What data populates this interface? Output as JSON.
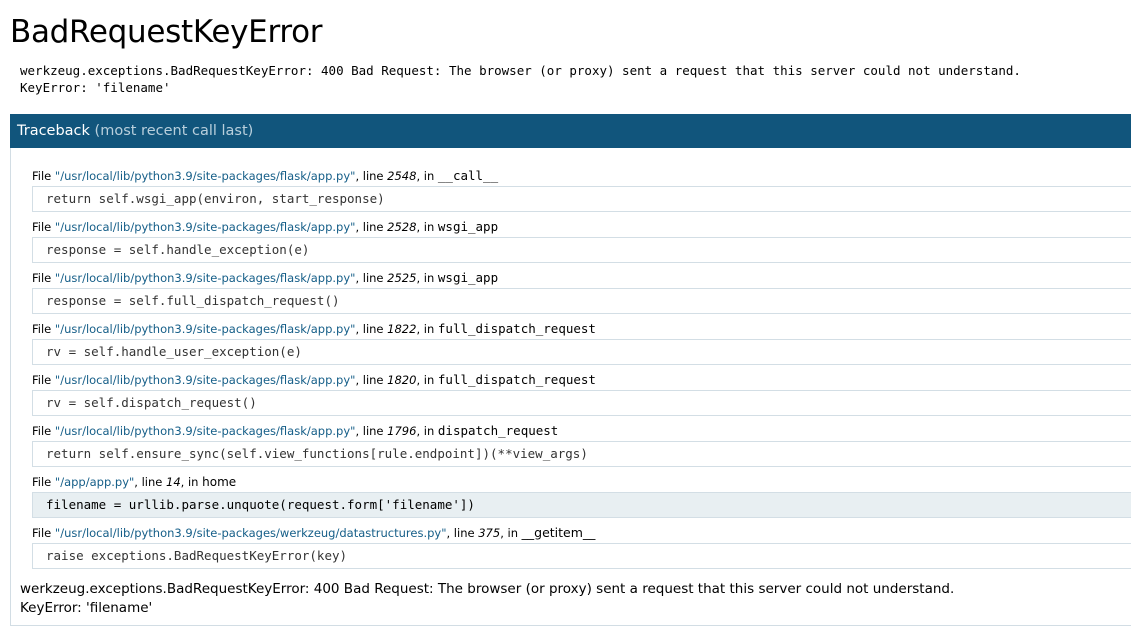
{
  "title": "BadRequestKeyError",
  "error_lines": [
    "werkzeug.exceptions.BadRequestKeyError: 400 Bad Request: The browser (or proxy) sent a request that this server could not understand.",
    "KeyError: 'filename'"
  ],
  "traceback": {
    "label": "Traceback",
    "sublabel": "(most recent call last)",
    "file_prefix": "File",
    "line_word": ", line",
    "in_word": ", in",
    "frames": [
      {
        "file": "\"/usr/local/lib/python3.9/site-packages/flask/app.py\"",
        "line": "2548",
        "func": "__call__",
        "code": "return self.wsgi_app(environ, start_response)",
        "current": false
      },
      {
        "file": "\"/usr/local/lib/python3.9/site-packages/flask/app.py\"",
        "line": "2528",
        "func": "wsgi_app",
        "code": "response = self.handle_exception(e)",
        "current": false
      },
      {
        "file": "\"/usr/local/lib/python3.9/site-packages/flask/app.py\"",
        "line": "2525",
        "func": "wsgi_app",
        "code": "response = self.full_dispatch_request()",
        "current": false
      },
      {
        "file": "\"/usr/local/lib/python3.9/site-packages/flask/app.py\"",
        "line": "1822",
        "func": "full_dispatch_request",
        "code": "rv = self.handle_user_exception(e)",
        "current": false
      },
      {
        "file": "\"/usr/local/lib/python3.9/site-packages/flask/app.py\"",
        "line": "1820",
        "func": "full_dispatch_request",
        "code": "rv = self.dispatch_request()",
        "current": false
      },
      {
        "file": "\"/usr/local/lib/python3.9/site-packages/flask/app.py\"",
        "line": "1796",
        "func": "dispatch_request",
        "code": "return self.ensure_sync(self.view_functions[rule.endpoint])(**view_args)",
        "current": false
      },
      {
        "file": "\"/app/app.py\"",
        "line": "14",
        "func": "home",
        "code": "filename = urllib.parse.unquote(request.form['filename'])",
        "current": true
      },
      {
        "file": "\"/usr/local/lib/python3.9/site-packages/werkzeug/datastructures.py\"",
        "line": "375",
        "func": "__getitem__",
        "code": "raise exceptions.BadRequestKeyError(key)",
        "current": false
      }
    ]
  },
  "footer_lines": [
    "werkzeug.exceptions.BadRequestKeyError: 400 Bad Request: The browser (or proxy) sent a request that this server could not understand.",
    "KeyError: 'filename'"
  ]
}
